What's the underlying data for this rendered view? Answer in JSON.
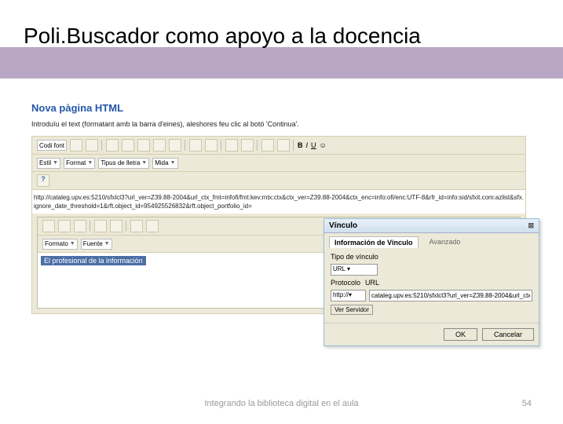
{
  "slide": {
    "title": "Poli.Buscador como apoyo a la docencia",
    "footer": "Integrando la biblioteca digital en el aula",
    "page_number": "54"
  },
  "page_heading": "Nova pàgina HTML",
  "intro_text": "Introduïu el text (formatant amb la barra d'eines), aleshores feu clic al botó 'Continua'.",
  "toolbar": {
    "source_label": "Codi font",
    "style_label": "Estil",
    "format_label": "Format",
    "font_label": "Tipus de lletra",
    "size_label": "Mida"
  },
  "icons": [
    "new",
    "save",
    "paste",
    "copy",
    "cut",
    "undo",
    "redo",
    "find",
    "replace",
    "selectall",
    "spellcheck",
    "bold",
    "italic",
    "underline",
    "strike",
    "sub",
    "sup"
  ],
  "url_block": "http://cataleg.upv.es:5210/sfxlcl3?url_ver=Z39.88-2004&url_ctx_fmt=infofi/fmt:kev:mtx:ctx&ctx_ver=Z39.88-2004&ctx_enc=info:ofi/enc:UTF-8&rfr_id=info:sid/sfxit.com:azlist&sfx.ignore_date_threshold=1&rft.object_id=954925526832&rft.object_portfolio_id=",
  "embedded": {
    "format_label": "Formato",
    "font_label": "Fuente",
    "selection_text": "El profesional de la información"
  },
  "dialog": {
    "title": "Vínculo",
    "tabs": {
      "info": "Información de Vínculo",
      "advanced": "Avanzado"
    },
    "type_label": "Tipo de vínculo",
    "type_value": "URL",
    "protocol_label": "Protocolo",
    "protocol_value": "http://",
    "url_label": "URL",
    "url_value": "cataleg.upv.es:5210/sfxlcl3?url_ver=Z39.88-2004&url_ctx",
    "browse_label": "Ver Servidor",
    "ok_label": "OK",
    "cancel_label": "Cancelar"
  }
}
